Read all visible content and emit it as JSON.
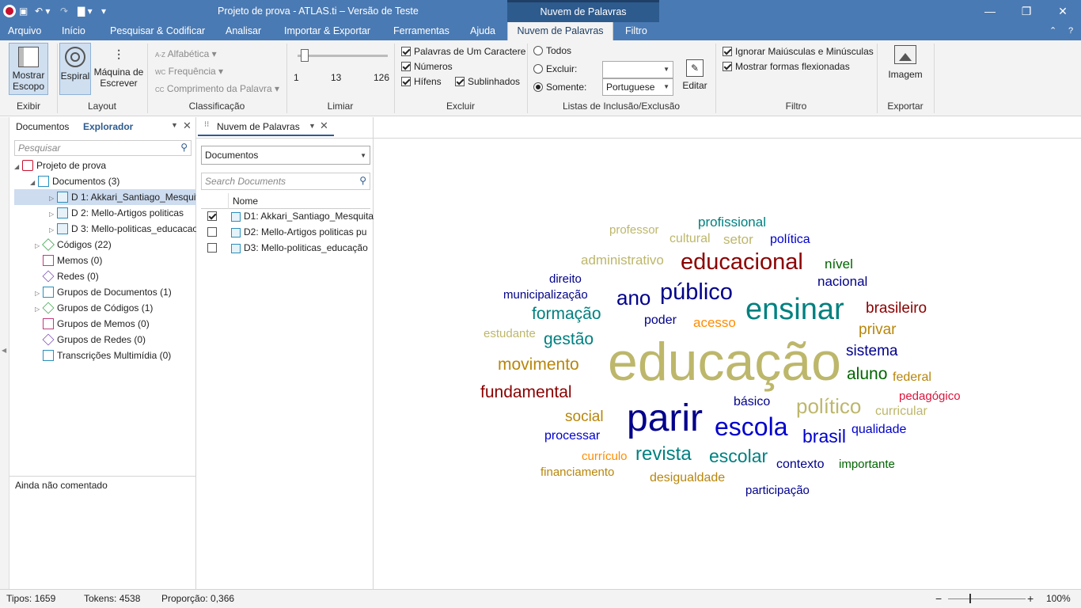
{
  "titlebar": {
    "title": "Projeto de prova - ATLAS.ti – Versão de Teste",
    "context_tab": "Nuvem de Palavras"
  },
  "tabs": [
    "Arquivo",
    "Início",
    "Pesquisar & Codificar",
    "Analisar",
    "Importar & Exportar",
    "Ferramentas",
    "Ajuda",
    "Nuvem de Palavras",
    "Filtro"
  ],
  "ribbon": {
    "exibir": {
      "btn": "Mostrar Escopo",
      "label": "Exibir"
    },
    "layout": {
      "spiral": "Espiral",
      "typewriter": "Máquina de Escrever",
      "label": "Layout"
    },
    "classificacao": {
      "alpha": "Alfabética",
      "freq": "Frequência",
      "length": "Comprimento da Palavra",
      "label": "Classificação",
      "alpha_prefix": "A-Z",
      "freq_prefix": "WC",
      "length_prefix": "CC"
    },
    "limiar": {
      "min": "1",
      "mid": "13",
      "max": "126",
      "label": "Limiar"
    },
    "excluir": {
      "single": "Palavras de Um Caractere",
      "numbers": "Números",
      "hyphens": "Hífens",
      "underscores": "Sublinhados",
      "label": "Excluir"
    },
    "listas": {
      "all": "Todos",
      "exclude": "Excluir:",
      "only": "Somente:",
      "language": "Portuguese",
      "edit": "Editar",
      "label": "Listas de Inclusão/Exclusão"
    },
    "filtro": {
      "ignore_case": "Ignorar Maiúsculas e Minúsculas",
      "inflected": "Mostrar formas flexionadas",
      "label": "Filtro"
    },
    "exportar": {
      "image": "Imagem",
      "label": "Exportar"
    }
  },
  "left": {
    "tab_docs": "Documentos",
    "tab_explorer": "Explorador",
    "search_placeholder": "Pesquisar",
    "tree": {
      "project": "Projeto de prova",
      "documents": "Documentos (3)",
      "d1": "D 1: Akkari_Santiago_Mesquita",
      "d2": "D 2: Mello-Artigos politicas",
      "d3": "D 3: Mello-politicas_educacao",
      "codes": "Códigos (22)",
      "memos": "Memos (0)",
      "networks": "Redes (0)",
      "doc_groups": "Grupos de Documentos (1)",
      "code_groups": "Grupos de Códigos (1)",
      "memo_groups": "Grupos de Memos (0)",
      "net_groups": "Grupos de Redes (0)",
      "multimedia": "Transcrições Multimídia (0)"
    },
    "comment": "Ainda não comentado"
  },
  "doc_panel": {
    "tab": "Nuvem de Palavras",
    "dropdown": "Documentos",
    "search_placeholder": "Search Documents",
    "col_name": "Nome",
    "rows": [
      "D1: Akkari_Santiago_Mesquita",
      "D2: Mello-Artigos politicas pu",
      "D3: Mello-politicas_educação"
    ]
  },
  "cloud": [
    {
      "t": "educação",
      "c": "#bdb76b"
    },
    {
      "t": "parir",
      "c": "#00008b"
    },
    {
      "t": "ensinar",
      "c": "#008080"
    },
    {
      "t": "educacional",
      "c": "#8b0000"
    },
    {
      "t": "público",
      "c": "#00008b"
    },
    {
      "t": "ano",
      "c": "#00008b"
    },
    {
      "t": "escola",
      "c": "#0000cd"
    },
    {
      "t": "político",
      "c": "#bdb76b"
    },
    {
      "t": "revista",
      "c": "#008080"
    },
    {
      "t": "fundamental",
      "c": "#8b0000"
    },
    {
      "t": "movimento",
      "c": "#b8860b"
    },
    {
      "t": "brasil",
      "c": "#0000cd"
    },
    {
      "t": "escolar",
      "c": "#008080"
    },
    {
      "t": "formação",
      "c": "#008080"
    },
    {
      "t": "gestão",
      "c": "#008080"
    },
    {
      "t": "brasileiro",
      "c": "#8b0000"
    },
    {
      "t": "sistema",
      "c": "#00008b"
    },
    {
      "t": "aluno",
      "c": "#006400"
    },
    {
      "t": "privar",
      "c": "#b8860b"
    },
    {
      "t": "social",
      "c": "#b8860b"
    },
    {
      "t": "nacional",
      "c": "#00008b"
    },
    {
      "t": "profissional",
      "c": "#008080"
    },
    {
      "t": "setor",
      "c": "#bdb76b"
    },
    {
      "t": "política",
      "c": "#0000cd"
    },
    {
      "t": "cultural",
      "c": "#bdb76b"
    },
    {
      "t": "professor",
      "c": "#bdb76b"
    },
    {
      "t": "administrativo",
      "c": "#bdb76b"
    },
    {
      "t": "nível",
      "c": "#006400"
    },
    {
      "t": "direito",
      "c": "#00008b"
    },
    {
      "t": "municipalização",
      "c": "#00008b"
    },
    {
      "t": "poder",
      "c": "#00008b"
    },
    {
      "t": "acesso",
      "c": "#ff8c00"
    },
    {
      "t": "estudante",
      "c": "#bdb76b"
    },
    {
      "t": "federal",
      "c": "#b8860b"
    },
    {
      "t": "pedagógico",
      "c": "#dc143c"
    },
    {
      "t": "básico",
      "c": "#00008b"
    },
    {
      "t": "curricular",
      "c": "#bdb76b"
    },
    {
      "t": "qualidade",
      "c": "#0000cd"
    },
    {
      "t": "processar",
      "c": "#0000cd"
    },
    {
      "t": "currículo",
      "c": "#ff8c00"
    },
    {
      "t": "contexto",
      "c": "#00008b"
    },
    {
      "t": "importante",
      "c": "#006400"
    },
    {
      "t": "financiamento",
      "c": "#b8860b"
    },
    {
      "t": "desigualdade",
      "c": "#b8860b"
    },
    {
      "t": "participação",
      "c": "#00008b"
    }
  ],
  "status": {
    "types": "Tipos: 1659",
    "tokens": "Tokens: 4538",
    "ratio": "Proporção: 0,366",
    "zoom": "100%"
  }
}
